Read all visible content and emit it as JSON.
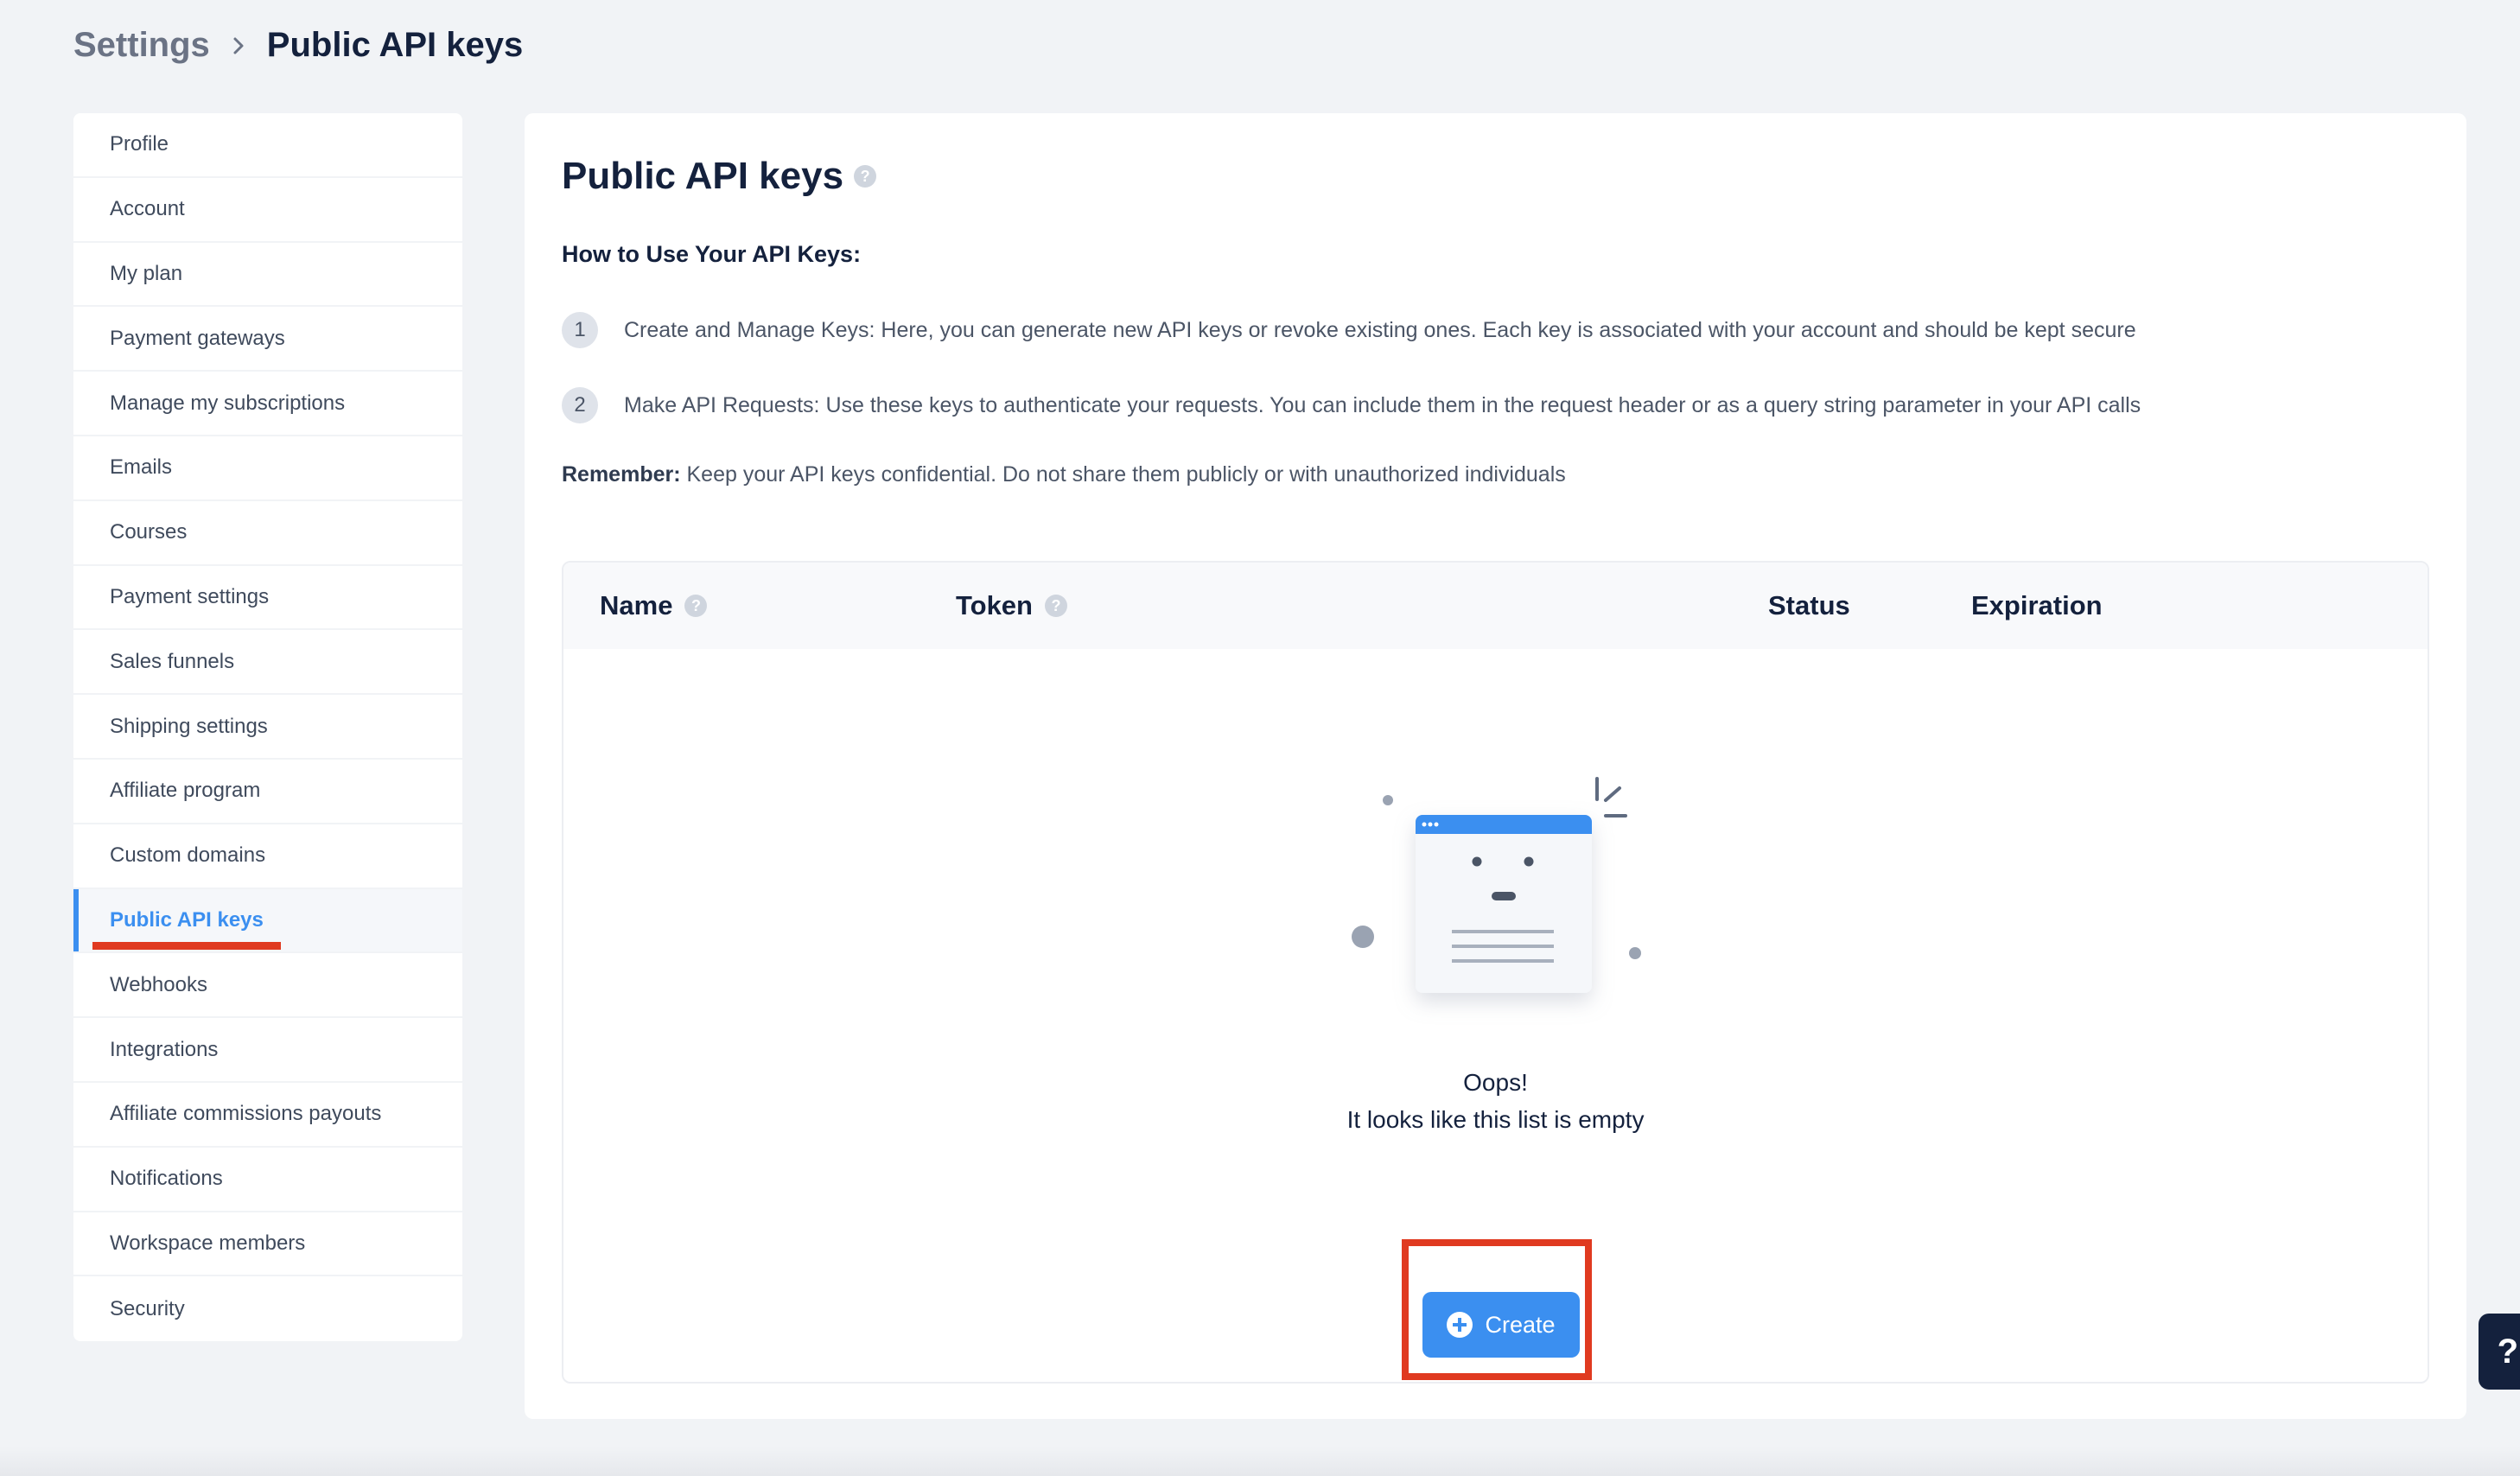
{
  "breadcrumb": {
    "parent": "Settings",
    "current": "Public API keys"
  },
  "sidebar": {
    "items": [
      {
        "label": "Profile"
      },
      {
        "label": "Account"
      },
      {
        "label": "My plan"
      },
      {
        "label": "Payment gateways"
      },
      {
        "label": "Manage my subscriptions"
      },
      {
        "label": "Emails"
      },
      {
        "label": "Courses"
      },
      {
        "label": "Payment settings"
      },
      {
        "label": "Sales funnels"
      },
      {
        "label": "Shipping settings"
      },
      {
        "label": "Affiliate program"
      },
      {
        "label": "Custom domains"
      },
      {
        "label": "Public API keys"
      },
      {
        "label": "Webhooks"
      },
      {
        "label": "Integrations"
      },
      {
        "label": "Affiliate commissions payouts"
      },
      {
        "label": "Notifications"
      },
      {
        "label": "Workspace members"
      },
      {
        "label": "Security"
      }
    ],
    "active": "Public API keys"
  },
  "main": {
    "title": "Public API keys",
    "help_glyph": "?",
    "how_title": "How to Use Your API Keys:",
    "steps": [
      {
        "num": "1",
        "text": "Create and Manage Keys: Here, you can generate new API keys or revoke existing ones. Each key is associated with your account and should be kept secure"
      },
      {
        "num": "2",
        "text": "Make API Requests: Use these keys to authenticate your requests. You can include them in the request header or as a query string parameter in your API calls"
      }
    ],
    "remember_label": "Remember:",
    "remember_text": " Keep your API keys confidential. Do not share them publicly or with unauthorized individuals"
  },
  "table": {
    "columns": [
      "Name",
      "Token",
      "Status",
      "Expiration"
    ],
    "empty_title": "Oops!",
    "empty_subtitle": "It looks like this list is empty",
    "create_label": "Create"
  },
  "help_widget": "?",
  "colors": {
    "accent": "#3b8ff0",
    "highlight": "#e03a20",
    "heading": "#14213d"
  }
}
